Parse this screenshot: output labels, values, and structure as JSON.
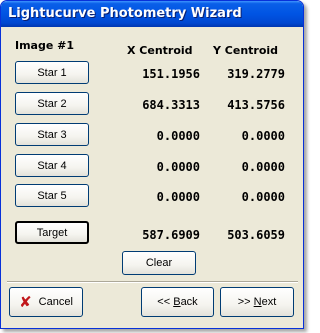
{
  "window": {
    "title": "Lightucurve Photometry Wizard"
  },
  "image_label": "Image #1",
  "columns": {
    "x": "X Centroid",
    "y": "Y Centroid"
  },
  "stars": [
    {
      "label": "Star 1",
      "x": "151.1956",
      "y": "319.2779"
    },
    {
      "label": "Star 2",
      "x": "684.3313",
      "y": "413.5756"
    },
    {
      "label": "Star 3",
      "x": "0.0000",
      "y": "0.0000"
    },
    {
      "label": "Star 4",
      "x": "0.0000",
      "y": "0.0000"
    },
    {
      "label": "Star 5",
      "x": "0.0000",
      "y": "0.0000"
    }
  ],
  "target": {
    "label": "Target",
    "x": "587.6909",
    "y": "503.6059"
  },
  "clear_label": "Clear",
  "nav": {
    "cancel_label": "Cancel",
    "cancel_icon": "✘",
    "back_arrows": "<<",
    "back_mnemonic": "B",
    "back_rest": "ack",
    "next_arrows": ">>",
    "next_mnemonic": "N",
    "next_rest": "ext"
  }
}
